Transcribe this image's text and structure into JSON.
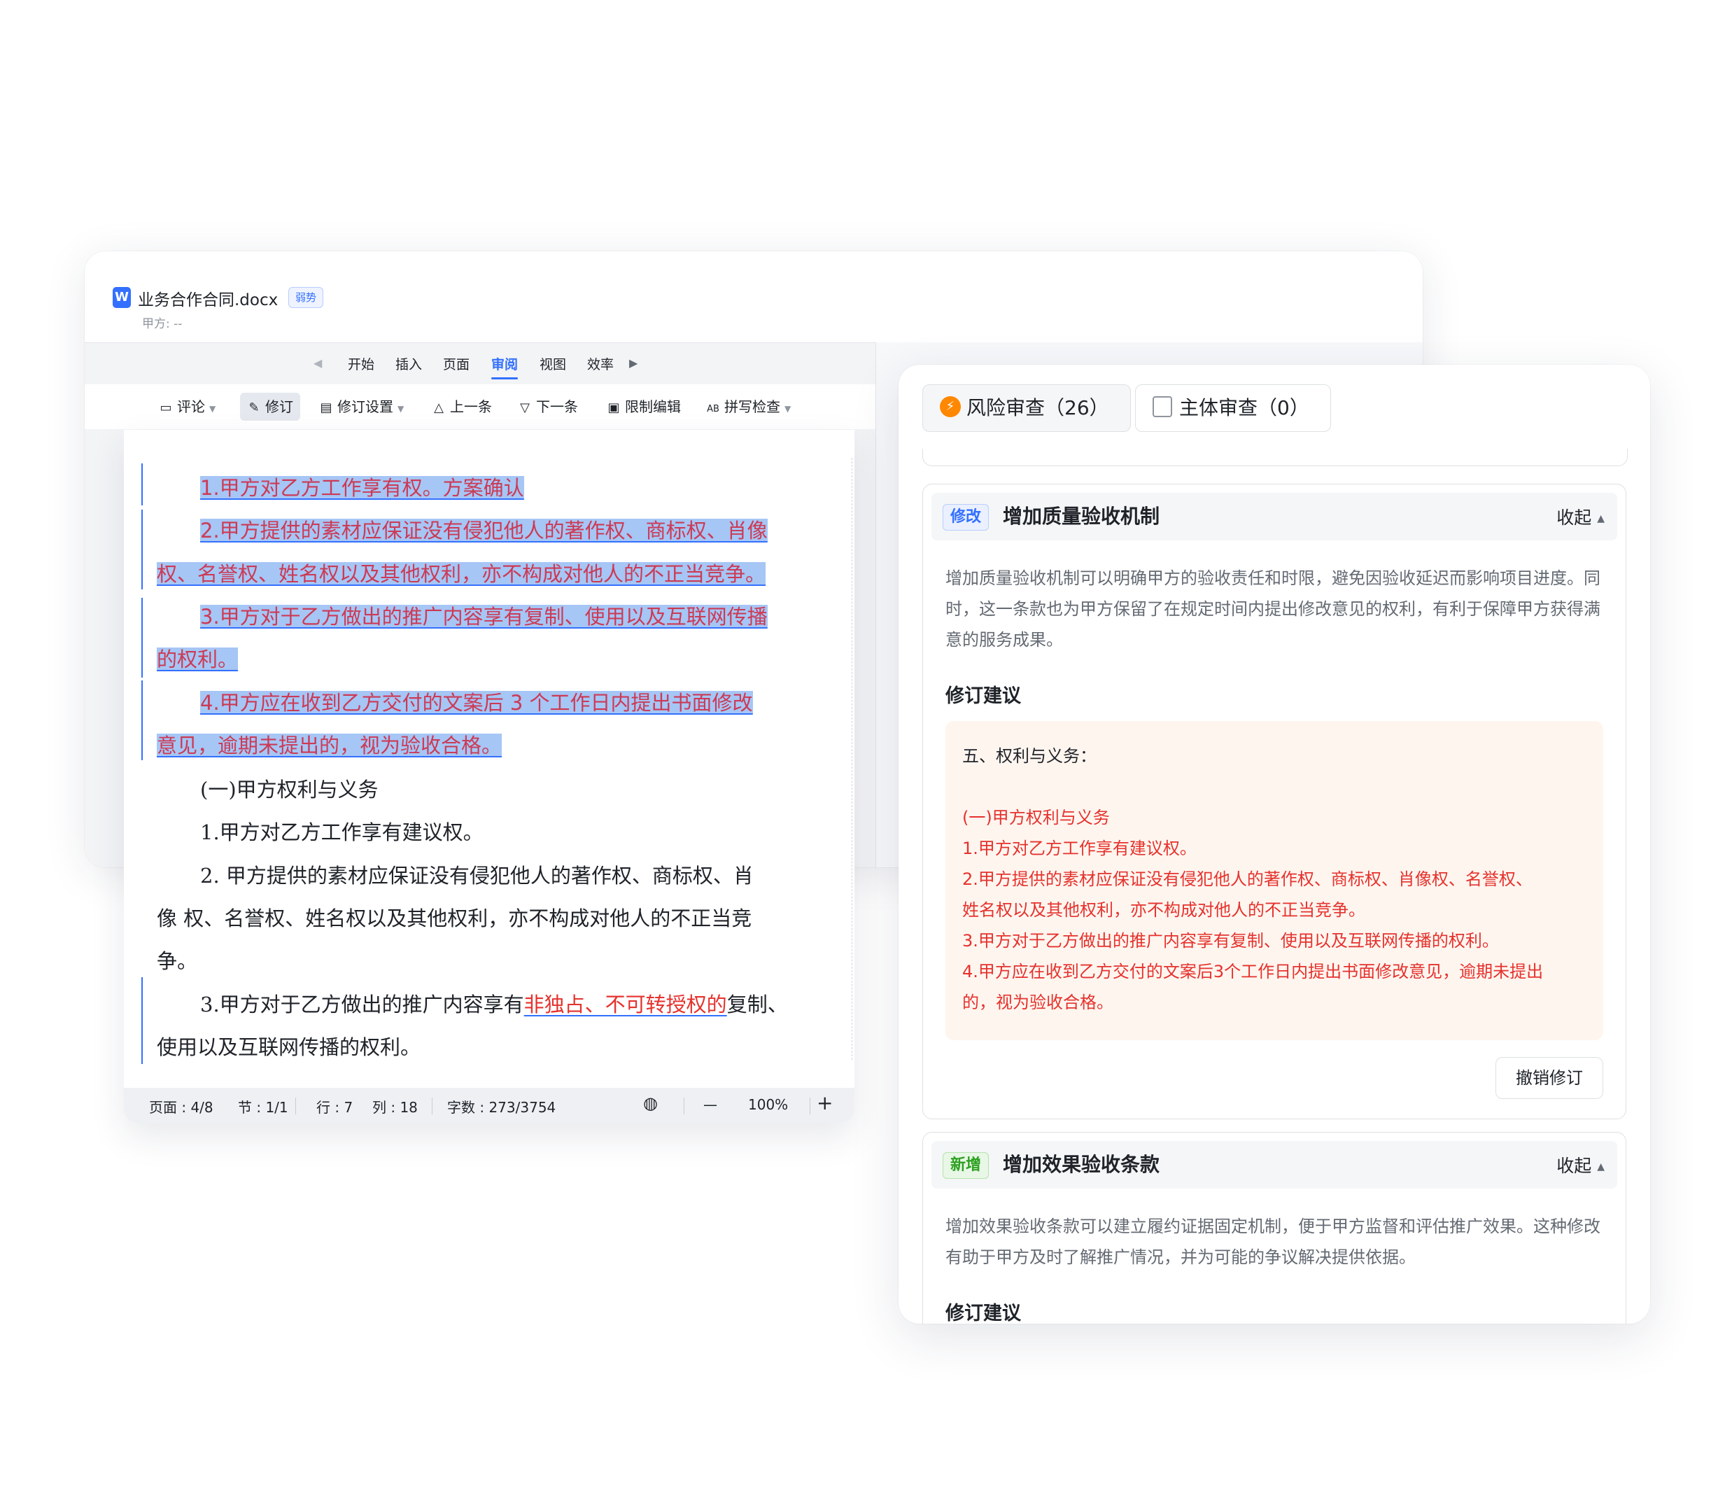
{
  "editor": {
    "file_name": "业务合作合同.docx",
    "badge": "弱势",
    "party": "甲方: --",
    "menu": [
      "开始",
      "插入",
      "页面",
      "审阅",
      "视图",
      "效率"
    ],
    "menu_active": "审阅",
    "toolbar": {
      "comment": "评论",
      "revise": "修订",
      "revise_settings": "修订设置",
      "prev": "上一条",
      "next": "下一条",
      "restrict": "限制编辑",
      "spell": "拼写检查"
    }
  },
  "document": {
    "highlighted": [
      "1.甲方对乙方工作享有权。方案确认",
      "2.甲方提供的素材应保证没有侵犯他人的著作权、商标权、肖像",
      "权、名誉权、姓名权以及其他权利，亦不构成对他人的不正当竞争。",
      "3.甲方对于乙方做出的推广内容享有复制、使用以及互联网传播",
      "的权利。",
      "4.甲方应在收到乙方交付的文案后 3 个工作日内提出书面修改",
      "意见，逾期未提出的，视为验收合格。"
    ],
    "body": [
      "(一)甲方权利与义务",
      "1.甲方对乙方工作享有建议权。",
      "2.  甲方提供的素材应保证没有侵犯他人的著作权、商标权、肖",
      "像    权、名誉权、姓名权以及其他权利，亦不构成对他人的不正当竞",
      "争。"
    ],
    "line3_prefix": "3.甲方对于乙方做出的推广内容享有",
    "line3_inserted": "非独占、不可转授权的",
    "line3_suffix": "复制、",
    "line3_cont": "使用以及互联网传播的权利。"
  },
  "status": {
    "page": "页面 : 4/8",
    "section": "节 : 1/1",
    "row": "行 : 7",
    "col": "列 : 18",
    "words": "字数 : 273/3754",
    "zoom": "100%",
    "minus": "—",
    "plus": "+"
  },
  "review": {
    "tab_risk": "风险审查（26）",
    "tab_subject": "主体审查（0）",
    "cards": [
      {
        "tag": "修改",
        "title": "增加质量验收机制",
        "collapse": "收起",
        "desc": "增加质量验收机制可以明确甲方的验收责任和时限，避免因验收延迟而影响项目进度。同时，这一条款也为甲方保留了在规定时间内提出修改意见的权利，有利于保障甲方获得满意的服务成果。",
        "suggest_title": "修订建议",
        "suggest_heading": "五、权利与义务：",
        "suggest_lines": [
          "(一)甲方权利与义务",
          "1.甲方对乙方工作享有建议权。",
          "2.甲方提供的素材应保证没有侵犯他人的著作权、商标权、肖像权、名誉权、",
          "姓名权以及其他权利，亦不构成对他人的不正当竞争。",
          "3.甲方对于乙方做出的推广内容享有复制、使用以及互联网传播的权利。",
          "4.甲方应在收到乙方交付的文案后3个工作日内提出书面修改意见，逾期未提出",
          "的，视为验收合格。"
        ],
        "undo": "撤销修订"
      },
      {
        "tag": "新增",
        "title": "增加效果验收条款",
        "collapse": "收起",
        "desc": "增加效果验收条款可以建立履约证据固定机制，便于甲方监督和评估推广效果。这种修改有助于甲方及时了解推广情况，并为可能的争议解决提供依据。",
        "suggest_title": "修订建议"
      }
    ]
  },
  "colors": {
    "accent": "#3370ff",
    "highlight": "#a6c6f5",
    "revision_text": "#e5322d",
    "risk_icon": "#ff8800",
    "suggest_bg": "#fff5ef"
  }
}
